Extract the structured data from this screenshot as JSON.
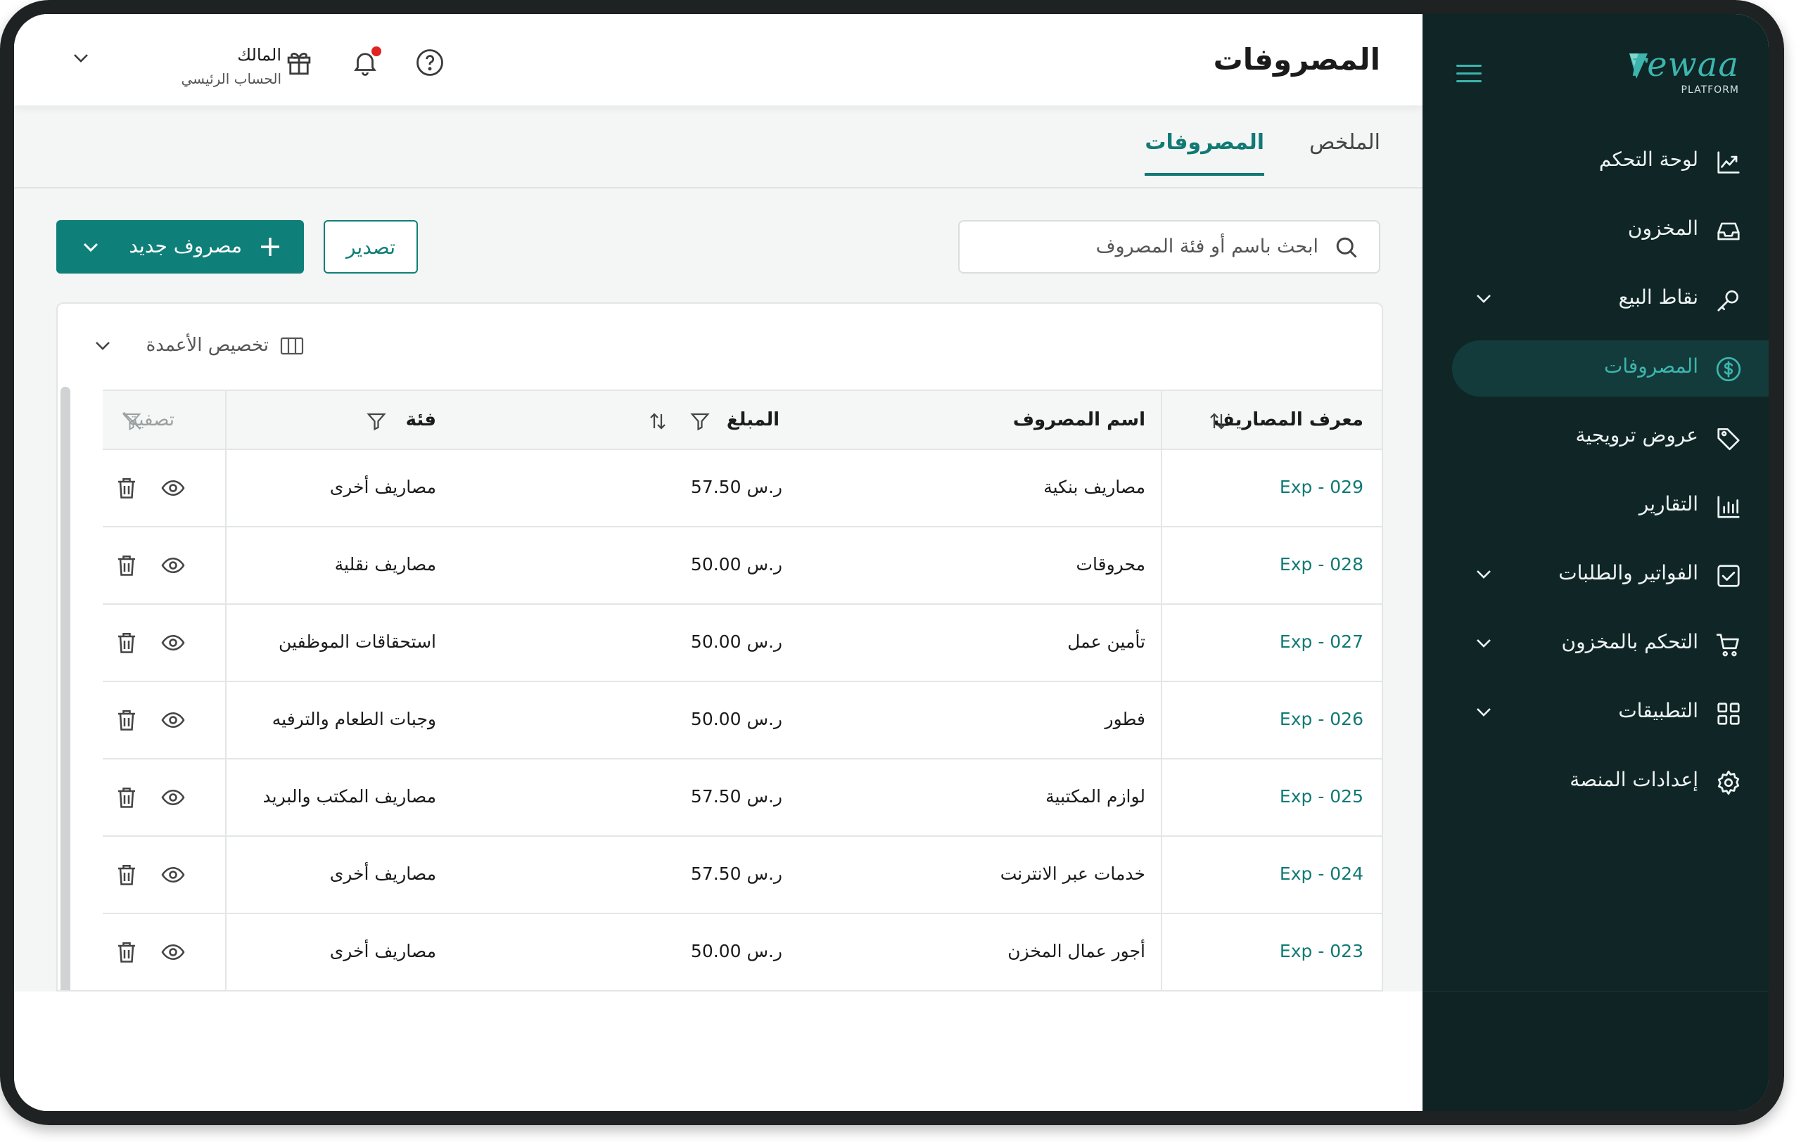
{
  "app": {
    "logo_text": "rewaa",
    "logo_sub": "PLATFORM",
    "brand_color": "#3db5ae",
    "accent_color": "#0f7f79"
  },
  "sidebar": {
    "items": [
      {
        "label": "لوحة التحكم",
        "icon": "line-chart-icon",
        "expandable": false,
        "active": false
      },
      {
        "label": "المخزون",
        "icon": "inbox-icon",
        "expandable": false,
        "active": false
      },
      {
        "label": "نقاط البيع",
        "icon": "key-icon",
        "expandable": true,
        "active": false
      },
      {
        "label": "المصروفات",
        "icon": "dollar-circle-icon",
        "expandable": false,
        "active": true
      },
      {
        "label": "عروض ترويجية",
        "icon": "tag-icon",
        "expandable": false,
        "active": false
      },
      {
        "label": "التقارير",
        "icon": "bar-chart-icon",
        "expandable": false,
        "active": false
      },
      {
        "label": "الفواتير والطلبات",
        "icon": "checkbox-icon",
        "expandable": true,
        "active": false
      },
      {
        "label": "التحكم بالمخزون",
        "icon": "cart-icon",
        "expandable": true,
        "active": false
      },
      {
        "label": "التطبيقات",
        "icon": "grid-icon",
        "expandable": true,
        "active": false
      },
      {
        "label": "إعدادات المنصة",
        "icon": "gear-icon",
        "expandable": false,
        "active": false
      }
    ]
  },
  "header": {
    "title": "المصروفات",
    "user_name": "المالك",
    "user_role": "الحساب الرئيسي"
  },
  "tabs": {
    "summary": "الملخص",
    "expenses": "المصروفات",
    "active": "expenses"
  },
  "toolbar": {
    "search_placeholder": "ابحث باسم أو فئة المصروف",
    "new_expense_label": "مصروف جديد",
    "export_label": "تصدير"
  },
  "table": {
    "customize_label": "تخصيص الأعمدة",
    "columns": {
      "id": "معرف المصاريف",
      "name": "اسم المصروف",
      "amount": "المبلغ",
      "category": "فئة",
      "filter": "تصفية"
    },
    "rows": [
      {
        "id": "Exp - 029",
        "name": "مصاريف بنكية",
        "amount": "57.50 ر.س",
        "category": "مصاريف أخرى"
      },
      {
        "id": "Exp - 028",
        "name": "محروقات",
        "amount": "50.00 ر.س",
        "category": "مصاريف نقلية"
      },
      {
        "id": "Exp - 027",
        "name": "تأمين عمل",
        "amount": "50.00 ر.س",
        "category": "استحقاقات الموظفين"
      },
      {
        "id": "Exp - 026",
        "name": "فطور",
        "amount": "50.00 ر.س",
        "category": "وجبات الطعام والترفيه"
      },
      {
        "id": "Exp - 025",
        "name": "لوازم المكتبية",
        "amount": "57.50 ر.س",
        "category": "مصاريف المكتب والبريد"
      },
      {
        "id": "Exp - 024",
        "name": "خدمات عبر الانترنت",
        "amount": "57.50 ر.س",
        "category": "مصاريف أخرى"
      },
      {
        "id": "Exp - 023",
        "name": "أجور عمال المخزن",
        "amount": "50.00 ر.س",
        "category": "مصاريف أخرى"
      }
    ]
  }
}
